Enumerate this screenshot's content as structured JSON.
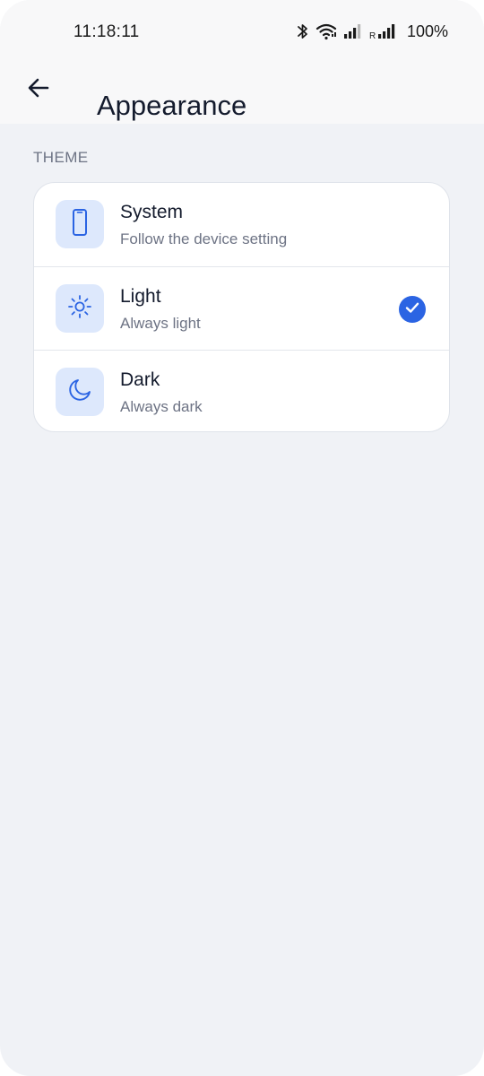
{
  "status_bar": {
    "time": "11:18:11",
    "battery": "100%",
    "icons": [
      "bluetooth-icon",
      "wifi-icon",
      "signal-icon",
      "roaming-signal-icon"
    ],
    "roaming_label": "R"
  },
  "app_bar": {
    "back_icon": "arrow-left-icon",
    "title": "Appearance"
  },
  "theme_section": {
    "label": "THEME",
    "selected": "Light",
    "accent_color": "#2b64e3",
    "options": [
      {
        "title": "System",
        "subtitle": "Follow the device setting",
        "icon": "phone-icon",
        "selected": false
      },
      {
        "title": "Light",
        "subtitle": "Always light",
        "icon": "sun-icon",
        "selected": true
      },
      {
        "title": "Dark",
        "subtitle": "Always dark",
        "icon": "moon-icon",
        "selected": false
      }
    ]
  }
}
